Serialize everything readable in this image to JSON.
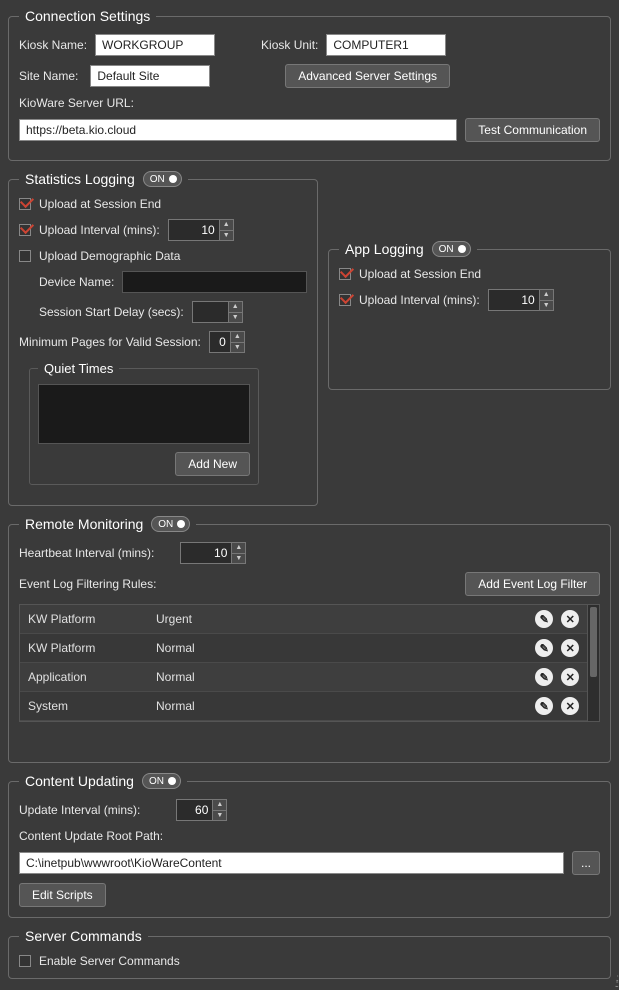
{
  "connection": {
    "legend": "Connection Settings",
    "kiosk_name_label": "Kiosk Name:",
    "kiosk_name": "WORKGROUP",
    "kiosk_unit_label": "Kiosk Unit:",
    "kiosk_unit": "COMPUTER1",
    "site_name_label": "Site Name:",
    "site_name": "Default Site",
    "adv_button": "Advanced Server Settings",
    "server_url_label": "KioWare Server URL:",
    "server_url": "https://beta.kio.cloud",
    "test_button": "Test Communication"
  },
  "stats": {
    "legend": "Statistics Logging",
    "toggle": "ON",
    "upload_session_end": "Upload at Session End",
    "upload_interval_label": "Upload Interval (mins):",
    "upload_interval": "10",
    "upload_demo": "Upload Demographic Data",
    "device_name_label": "Device Name:",
    "device_name": "",
    "session_delay_label": "Session Start Delay (secs):",
    "session_delay": "",
    "min_pages_label": "Minimum Pages for Valid Session:",
    "min_pages": "0",
    "quiet_times": "Quiet Times",
    "add_new": "Add New"
  },
  "applog": {
    "legend": "App Logging",
    "toggle": "ON",
    "upload_session_end": "Upload at Session End",
    "upload_interval_label": "Upload Interval (mins):",
    "upload_interval": "10"
  },
  "remote": {
    "legend": "Remote Monitoring",
    "toggle": "ON",
    "heartbeat_label": "Heartbeat Interval (mins):",
    "heartbeat": "10",
    "filter_label": "Event Log Filtering Rules:",
    "add_filter": "Add Event Log Filter",
    "rows": [
      {
        "c1": "KW Platform",
        "c2": "Urgent"
      },
      {
        "c1": "KW Platform",
        "c2": "Normal"
      },
      {
        "c1": "Application",
        "c2": "Normal"
      },
      {
        "c1": "System",
        "c2": "Normal"
      }
    ]
  },
  "content": {
    "legend": "Content Updating",
    "toggle": "ON",
    "interval_label": "Update Interval (mins):",
    "interval": "60",
    "root_label": "Content Update Root Path:",
    "root": "C:\\inetpub\\wwwroot\\KioWareContent",
    "browse": "...",
    "edit_scripts": "Edit Scripts"
  },
  "server_cmds": {
    "legend": "Server Commands",
    "enable": "Enable Server Commands"
  }
}
